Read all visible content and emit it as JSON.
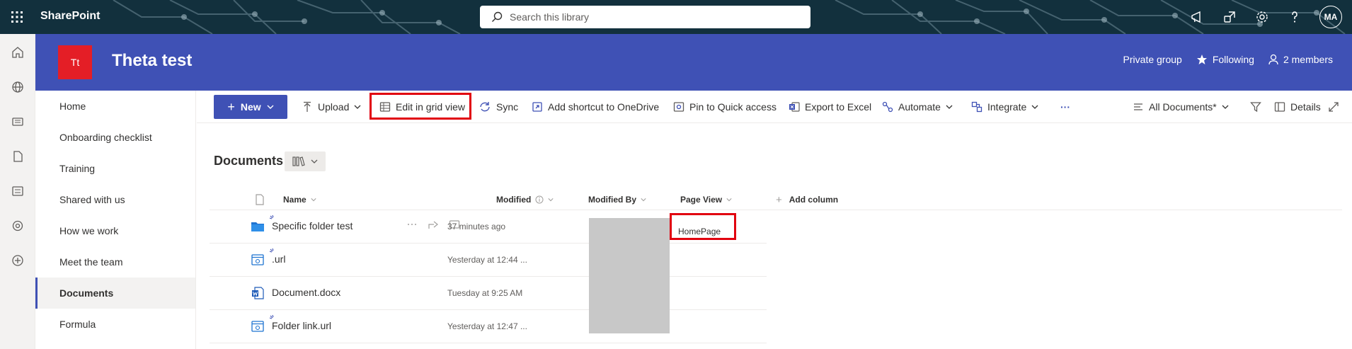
{
  "suite": {
    "brand": "SharePoint",
    "search_placeholder": "Search this library",
    "avatar_initials": "MA",
    "icons": [
      "app-launcher-icon",
      "megaphone-icon",
      "share-icon",
      "settings-icon",
      "help-icon"
    ]
  },
  "appbar": {
    "icons": [
      "home-icon",
      "globe-icon",
      "news-icon",
      "files-icon",
      "lists-icon",
      "loop-icon",
      "add-icon"
    ]
  },
  "site": {
    "logo_initials": "Tt",
    "logo_color": "#e41e26",
    "title": "Theta test",
    "privacy": "Private group",
    "following_label": "Following",
    "members_label": "2 members",
    "header_color": "#3f51b5"
  },
  "nav": {
    "items": [
      {
        "label": "Home"
      },
      {
        "label": "Onboarding checklist"
      },
      {
        "label": "Training"
      },
      {
        "label": "Shared with us"
      },
      {
        "label": "How we work"
      },
      {
        "label": "Meet the team"
      },
      {
        "label": "Documents",
        "active": true
      },
      {
        "label": "Formula"
      }
    ]
  },
  "commands": {
    "new": "New",
    "upload": "Upload",
    "edit_grid": "Edit in grid view",
    "sync": "Sync",
    "add_shortcut": "Add shortcut to OneDrive",
    "pin": "Pin to Quick access",
    "export": "Export to Excel",
    "automate": "Automate",
    "integrate": "Integrate",
    "more": "···",
    "view_name": "All Documents*",
    "details": "Details"
  },
  "library": {
    "title": "Documents",
    "columns": {
      "name": "Name",
      "modified": "Modified",
      "modified_by": "Modified By",
      "page_view": "Page View",
      "add_column": "Add column"
    },
    "rows": [
      {
        "name": "Specific folder test",
        "modified": "37 minutes ago",
        "type": "folder",
        "page_view": "HomePage"
      },
      {
        "name": ".url",
        "modified": "Yesterday at 12:44 ...",
        "type": "url"
      },
      {
        "name": "Document.docx",
        "modified": "Tuesday at 9:25 AM",
        "type": "docx"
      },
      {
        "name": "Folder link.url",
        "modified": "Yesterday at 12:47 ...",
        "type": "url"
      }
    ]
  },
  "highlight_color": "#e1000f"
}
